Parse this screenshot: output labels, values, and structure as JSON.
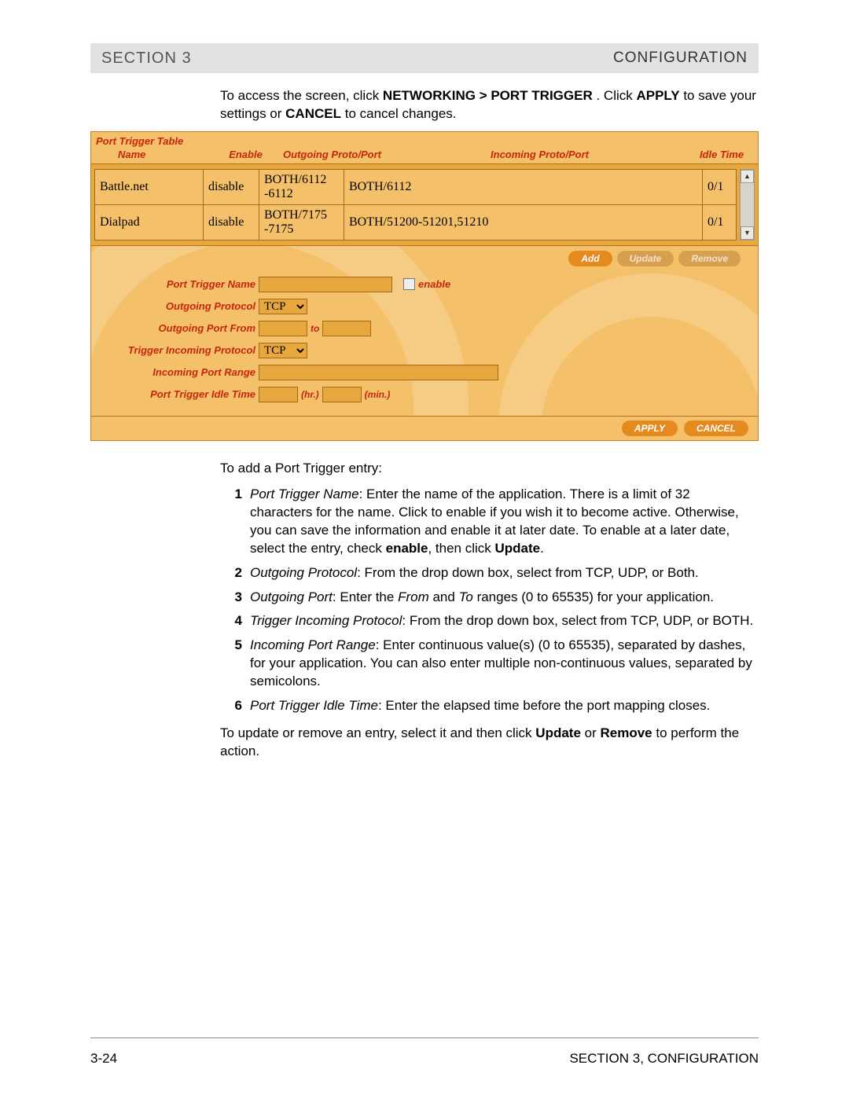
{
  "header": {
    "left": "SECTION 3",
    "right": "CONFIGURATION"
  },
  "intro_parts": {
    "p1": "To access the screen, click ",
    "b1": "NETWORKING > PORT TRIGGER",
    "p2": ". Click ",
    "b2": "APPLY",
    "p3": " to save your settings or ",
    "b3": "CANCEL",
    "p4": " to cancel changes."
  },
  "panel": {
    "table_title": "Port Trigger Table",
    "headers": {
      "name": "Name",
      "enable": "Enable",
      "outgoing": "Outgoing Proto/Port",
      "incoming": "Incoming Proto/Port",
      "idle": "Idle Time"
    },
    "rows": [
      {
        "name": "Battle.net",
        "enable": "disable",
        "out": "BOTH/6112 -6112",
        "in": "BOTH/6112",
        "ratio": "0/1"
      },
      {
        "name": "Dialpad",
        "enable": "disable",
        "out": "BOTH/7175 -7175",
        "in": "BOTH/51200-51201,51210",
        "ratio": "0/1"
      }
    ],
    "buttons": {
      "add": "Add",
      "update": "Update",
      "remove": "Remove"
    },
    "form": {
      "name_label": "Port Trigger Name",
      "enable_label": "enable",
      "out_proto_label": "Outgoing Protocol",
      "out_proto_value": "TCP",
      "out_port_label": "Outgoing Port From",
      "to_label": "to",
      "in_proto_label": "Trigger Incoming Protocol",
      "in_proto_value": "TCP",
      "in_range_label": "Incoming Port Range",
      "idle_label": "Port Trigger Idle Time",
      "hr": "(hr.)",
      "min": "(min.)"
    },
    "bottom": {
      "apply": "APPLY",
      "cancel": "CANCEL"
    }
  },
  "after_panel_intro": "To add a Port Trigger entry:",
  "list": [
    {
      "n": "1",
      "term": "Port Trigger Name",
      "t1": ": Enter the name of the application. There is a limit of 32 characters for the name. Click to enable if you wish it to become active. Otherwise, you can save the information and enable it at later date. To enable at a later date, select the entry, check ",
      "b1": "enable",
      "t2": ", then click ",
      "b2": "Update",
      "t3": "."
    },
    {
      "n": "2",
      "term": "Outgoing Protocol",
      "t1": ": From the drop down box, select from TCP, UDP, or Both."
    },
    {
      "n": "3",
      "term": "Outgoing Port",
      "t1": ": Enter the ",
      "i1": "From",
      "t2": " and ",
      "i2": "To",
      "t3": " ranges (0 to 65535) for your application."
    },
    {
      "n": "4",
      "term": "Trigger Incoming Protocol",
      "t1": ": From the drop down box, select from TCP, UDP, or BOTH."
    },
    {
      "n": "5",
      "term": "Incoming Port Range",
      "t1": ": Enter continuous value(s) (0 to 65535), separated by dashes, for your application. You can also enter multiple non-continuous values, separated by semicolons."
    },
    {
      "n": "6",
      "term": "Port Trigger Idle Time",
      "t1": ": Enter the elapsed time before the port mapping closes."
    }
  ],
  "closing": {
    "p1": "To update or remove an entry, select it and then click ",
    "b1": "Update",
    "p2": " or ",
    "b2": "Remove",
    "p3": " to perform the action."
  },
  "footer": {
    "left": "3-24",
    "right": "SECTION 3, CONFIGURATION"
  }
}
